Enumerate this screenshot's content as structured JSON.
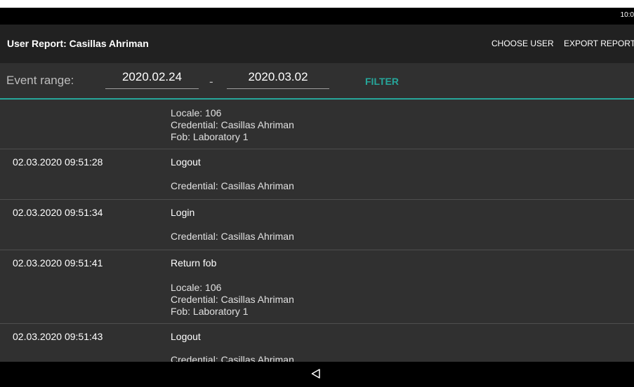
{
  "status_bar": {
    "time": "10:0"
  },
  "app_bar": {
    "title": "User Report: Casillas Ahriman",
    "choose_user": "CHOOSE USER",
    "export_report": "EXPORT REPORT"
  },
  "filter": {
    "label": "Event range:",
    "from": "2020.02.24",
    "separator": "-",
    "to": "2020.03.02",
    "button": "FILTER"
  },
  "events": [
    {
      "time": "",
      "type": "",
      "details": [
        "Locale: 106",
        "Credential: Casillas Ahriman",
        "Fob: Laboratory 1"
      ]
    },
    {
      "time": "02.03.2020 09:51:28",
      "type": "Logout",
      "details": [
        "Credential: Casillas Ahriman"
      ]
    },
    {
      "time": "02.03.2020 09:51:34",
      "type": "Login",
      "details": [
        "Credential: Casillas Ahriman"
      ]
    },
    {
      "time": "02.03.2020 09:51:41",
      "type": "Return fob",
      "details": [
        "Locale: 106",
        "Credential: Casillas Ahriman",
        "Fob: Laboratory 1"
      ]
    },
    {
      "time": "02.03.2020 09:51:43",
      "type": "Logout",
      "details": [
        "Credential: Casillas Ahriman"
      ]
    }
  ],
  "icons": {
    "back": "back-triangle-icon"
  },
  "colors": {
    "accent": "#26a69a",
    "background": "#303030",
    "app_bar": "#212121"
  }
}
